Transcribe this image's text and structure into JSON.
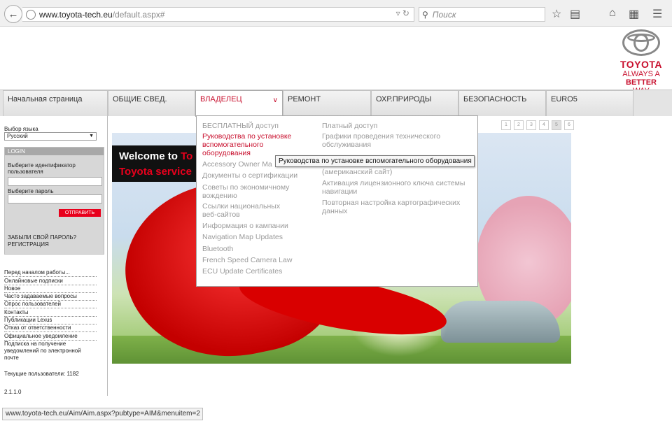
{
  "browser": {
    "url_host": "www.toyota-tech.eu",
    "url_path": "/default.aspx#",
    "search_placeholder": "Поиск"
  },
  "logo": {
    "word": "TOYOTA",
    "tag1": "ALWAYS A",
    "tag2_bold": "BETTER",
    "tag2_rest": " WAY"
  },
  "nav": {
    "tabs": [
      "Начальная страница",
      "ОБЩИЕ СВЕД.",
      "ВЛАДЕЛЕЦ",
      "РЕМОНТ",
      "ОХР.ПРИРОДЫ",
      "БЕЗОПАСНОСТЬ",
      "EURO5"
    ]
  },
  "dropdown": {
    "left": [
      "БЕСПЛАТНЫЙ доступ",
      "Руководства по установке вспомогательного оборудования",
      "Accessory Owner Ma",
      "Документы о сертификации",
      "Советы по экономичному вождению",
      "Ссылки национальных веб-сайтов",
      "Информация о кампании",
      "Navigation Map Updates",
      "Bluetooth",
      "French Speed Camera Law",
      "ECU Update Certificates"
    ],
    "right": [
      "Платный доступ",
      "Графики проведения технического обслуживания",
      "(американский сайт)",
      "Активация лицензионного ключа системы навигации",
      "Повторная настройка картографических данных"
    ],
    "tooltip": "Руководства по установке вспомогательного оборудования"
  },
  "sidebar": {
    "lang_label": "Выбор языка",
    "lang_value": "Русский",
    "login_title": "LOGIN",
    "user_label": "Выберите идентификатор пользователя",
    "pass_label": "Выберите пароль",
    "submit": "ОТПРАВИТЬ",
    "forgot": "ЗАБЫЛИ СВОЙ ПАРОЛЬ?",
    "register": "РЕГИСТРАЦИЯ",
    "links": [
      "Перед началом работы...",
      "Онлайновые подписки",
      "Новое",
      "Часто задаваемые вопросы",
      "Опрос пользователей",
      "Контакты",
      "Публикации Lexus",
      "Отказ от ответственности",
      "Официальное уведомление",
      "Подписка на получение уведомлений по электронной почте"
    ],
    "users": "Текущие пользователи: 1182",
    "version": "2.1.1.0"
  },
  "pager": [
    "1",
    "2",
    "3",
    "4",
    "5",
    "6"
  ],
  "banner": {
    "line1_white": "Welcome to ",
    "line1_red": "To",
    "line2_red": "Toyota service"
  },
  "status_url": "www.toyota-tech.eu/Aim/Aim.aspx?pubtype=AIM&menuitem=2",
  "colors": {
    "brand_red": "#c8102e"
  }
}
